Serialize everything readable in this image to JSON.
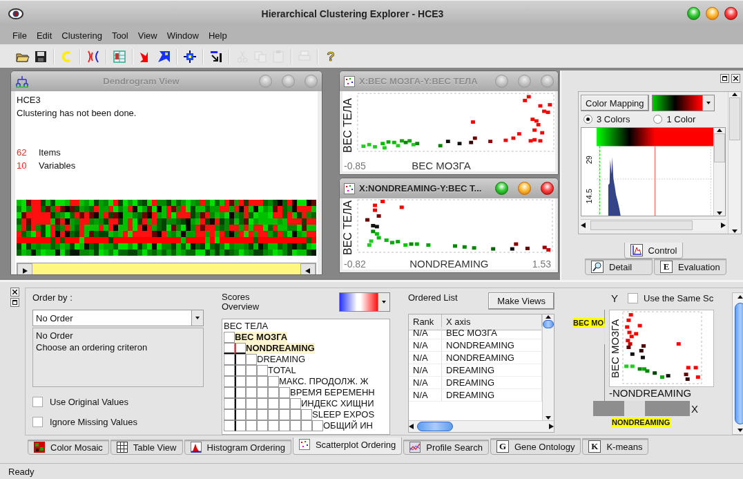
{
  "window": {
    "title": "Hierarchical Clustering Explorer - HCE3"
  },
  "menu": [
    "File",
    "Edit",
    "Clustering",
    "Tool",
    "View",
    "Window",
    "Help"
  ],
  "toolbar": [
    {
      "kind": "open",
      "disabled": false
    },
    {
      "kind": "save",
      "disabled": false
    },
    {
      "kind": "separator"
    },
    {
      "kind": "arc",
      "disabled": false
    },
    {
      "kind": "separator"
    },
    {
      "kind": "branch",
      "disabled": false
    },
    {
      "kind": "separator"
    },
    {
      "kind": "grid",
      "disabled": false
    },
    {
      "kind": "separator"
    },
    {
      "kind": "arrow_red",
      "disabled": false
    },
    {
      "kind": "arrow_blue",
      "disabled": false
    },
    {
      "kind": "separator"
    },
    {
      "kind": "move",
      "disabled": false
    },
    {
      "kind": "separator"
    },
    {
      "kind": "pointer",
      "disabled": false
    },
    {
      "kind": "separator"
    },
    {
      "kind": "cut",
      "disabled": true
    },
    {
      "kind": "copy",
      "disabled": true
    },
    {
      "kind": "paste",
      "disabled": true
    },
    {
      "kind": "separator"
    },
    {
      "kind": "print",
      "disabled": true
    },
    {
      "kind": "separator"
    },
    {
      "kind": "help",
      "glyph": "?",
      "disabled": false
    }
  ],
  "dendrogram_window": {
    "title": "Dendrogram View",
    "active": false,
    "lines": [
      "HCE3",
      "Clustering has not been done."
    ],
    "counts": [
      {
        "value": "62",
        "label": "Items"
      },
      {
        "value": "10",
        "label": "Variables"
      }
    ]
  },
  "scatter_windows": [
    {
      "title": "X:ВЕС МОЗГА-Y:ВЕС ТЕЛА",
      "active": false,
      "ylabel": "ВЕС ТЕЛА",
      "xlabel": "ВЕС МОЗГА",
      "xmin": "-0.85"
    },
    {
      "title": "X:NONDREAMING-Y:ВЕС Т...",
      "active": true,
      "ylabel": "ВЕС ТЕЛА",
      "xlabel": "NONDREAMING",
      "xmin": "-0.82",
      "xmax": "1.53"
    }
  ],
  "control_panel": {
    "color_mapping_button": "Color Mapping",
    "color_modes": [
      {
        "label": "3 Colors",
        "selected": true
      },
      {
        "label": "1 Color",
        "selected": false
      }
    ],
    "histogram_ticks": [
      "29",
      "14.5"
    ],
    "tabs": [
      {
        "label": "Control",
        "kind": "chart",
        "selected": true
      },
      {
        "label": "Detail",
        "kind": "magnifier",
        "selected": false
      },
      {
        "label": "Evaluation",
        "kind": "letter",
        "glyph": "E",
        "selected": false
      }
    ]
  },
  "ordering": {
    "order_by_label": "Order by :",
    "order_select": "No Order",
    "description": [
      "No Order",
      "Choose an ordering criteron"
    ],
    "options": [
      {
        "label": "Use Original Values",
        "checked": false
      },
      {
        "label": "Ignore Missing Values",
        "checked": false
      }
    ]
  },
  "scores_overview": {
    "title": "Scores Overview",
    "variables": [
      {
        "label": "ВЕС ТЕЛА",
        "selected": false
      },
      {
        "label": "ВЕС МОЗГА",
        "selected": true
      },
      {
        "label": "NONDREAMING",
        "selected": true
      },
      {
        "label": "DREAMING",
        "selected": false
      },
      {
        "label": "TOTAL",
        "selected": false
      },
      {
        "label": "МАКС. ПРОДОЛЖ. Ж",
        "selected": false
      },
      {
        "label": "ВРЕМЯ БЕРЕМЕНН",
        "selected": false
      },
      {
        "label": "ИНДЕКС ХИЩНИ",
        "selected": false
      },
      {
        "label": "SLEEP EXPOS",
        "selected": false
      },
      {
        "label": "ОБЩИЙ ИН",
        "selected": false
      }
    ]
  },
  "ordered_list": {
    "title": "Ordered List",
    "button": "Make Views",
    "columns": [
      "Rank",
      "X axis"
    ],
    "rows": [
      [
        "N/A",
        "ВЕС МОЗГА"
      ],
      [
        "N/A",
        "NONDREAMING"
      ],
      [
        "N/A",
        "NONDREAMING"
      ],
      [
        "N/A",
        "DREAMING"
      ],
      [
        "N/A",
        "DREAMING"
      ],
      [
        "N/A",
        "DREAMING"
      ]
    ]
  },
  "scatter_preview": {
    "y_title": "Y",
    "same_scale": {
      "label": "Use the Same Sc",
      "checked": false
    },
    "y_variable": "ВЕС МО",
    "ylabel": "ВЕС МОЗГА",
    "xlabel": "-NONDREAMING",
    "x_title": "X",
    "x_variable": "NONDREAMING"
  },
  "tabs": [
    {
      "label": "Color Mosaic",
      "kind": "mosaic",
      "selected": false
    },
    {
      "label": "Table View",
      "kind": "table",
      "selected": false
    },
    {
      "label": "Histogram Ordering",
      "kind": "histogram",
      "selected": false
    },
    {
      "label": "Scatterplot Ordering",
      "kind": "scatter",
      "selected": true
    },
    {
      "label": "Profile Search",
      "kind": "profile",
      "selected": false
    },
    {
      "label": "Gene Ontology",
      "kind": "letter",
      "glyph": "G",
      "selected": false
    },
    {
      "label": "K-means",
      "kind": "letter",
      "glyph": "K",
      "selected": false
    }
  ],
  "status_bar": "Ready"
}
